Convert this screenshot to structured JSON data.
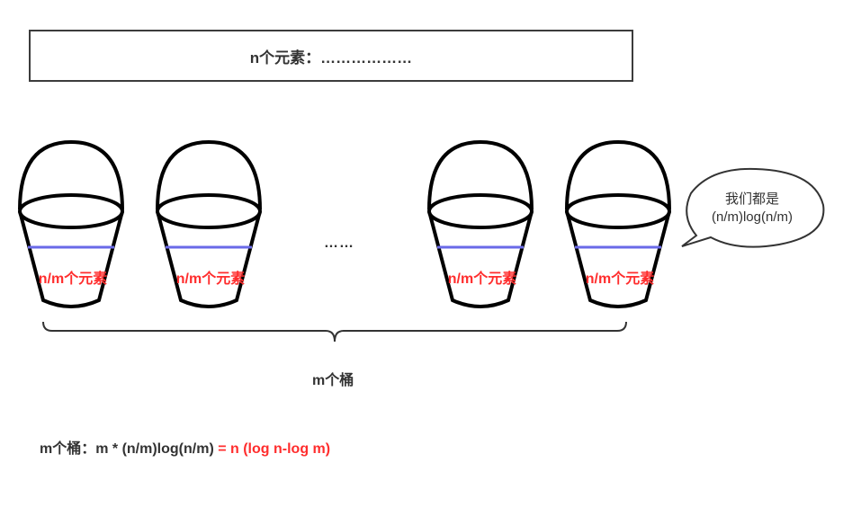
{
  "top_box": {
    "text": "n个元素：………………"
  },
  "bucket_label": "n/m个元素",
  "ellipsis": "……",
  "brace_label": "m个桶",
  "callout": {
    "line1": "我们都是",
    "line2": "(n/m)log(n/m)"
  },
  "formula": {
    "prefix": "m个桶：m * (n/m)log(n/m) ",
    "highlight": " = n (log n-log m)"
  },
  "colors": {
    "stroke": "#000000",
    "fill_line": "#6a6ae8",
    "accent": "#ff2d2d",
    "text": "#333333"
  }
}
